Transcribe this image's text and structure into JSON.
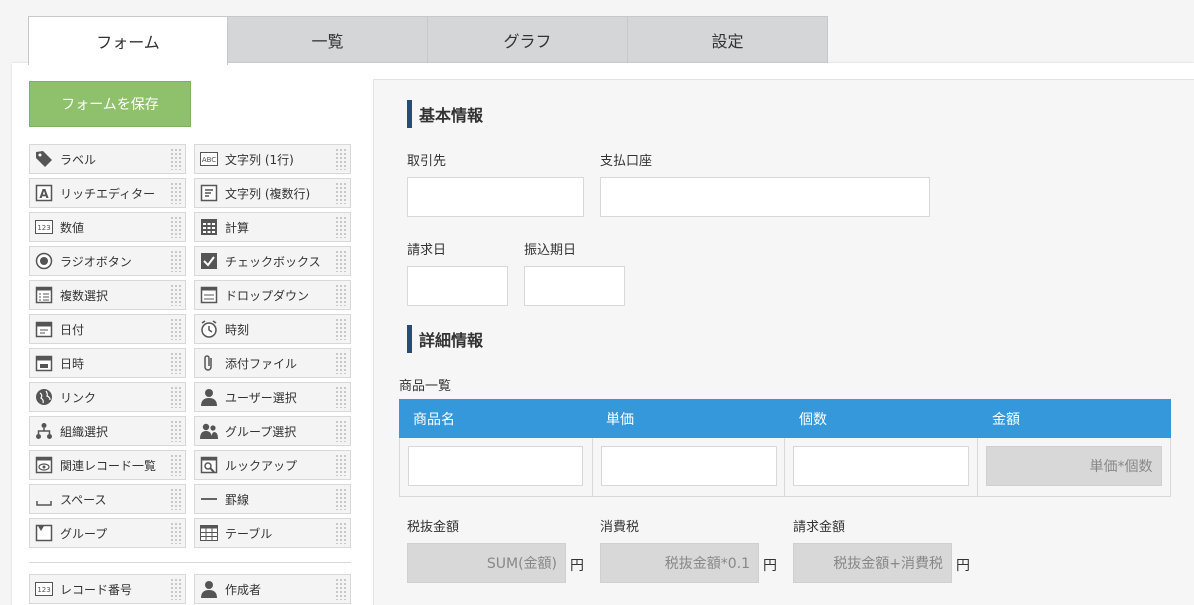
{
  "tabs": [
    {
      "label": "フォーム"
    },
    {
      "label": "一覧"
    },
    {
      "label": "グラフ"
    },
    {
      "label": "設定"
    }
  ],
  "save_button": "フォームを保存",
  "palette": [
    {
      "label": "ラベル",
      "icon": "tag-icon"
    },
    {
      "label": "文字列 (1行)",
      "icon": "abc-icon"
    },
    {
      "label": "リッチエディター",
      "icon": "rich-editor-icon"
    },
    {
      "label": "文字列 (複数行)",
      "icon": "multiline-text-icon"
    },
    {
      "label": "数値",
      "icon": "number-icon"
    },
    {
      "label": "計算",
      "icon": "calculator-icon"
    },
    {
      "label": "ラジオボタン",
      "icon": "radio-icon"
    },
    {
      "label": "チェックボックス",
      "icon": "checkbox-icon"
    },
    {
      "label": "複数選択",
      "icon": "multi-select-icon"
    },
    {
      "label": "ドロップダウン",
      "icon": "dropdown-icon"
    },
    {
      "label": "日付",
      "icon": "date-icon"
    },
    {
      "label": "時刻",
      "icon": "clock-icon"
    },
    {
      "label": "日時",
      "icon": "datetime-icon"
    },
    {
      "label": "添付ファイル",
      "icon": "paperclip-icon"
    },
    {
      "label": "リンク",
      "icon": "globe-icon"
    },
    {
      "label": "ユーザー選択",
      "icon": "user-icon"
    },
    {
      "label": "組織選択",
      "icon": "org-icon"
    },
    {
      "label": "グループ選択",
      "icon": "group-icon"
    },
    {
      "label": "関連レコード一覧",
      "icon": "related-records-icon"
    },
    {
      "label": "ルックアップ",
      "icon": "lookup-icon"
    },
    {
      "label": "スペース",
      "icon": "space-icon"
    },
    {
      "label": "罫線",
      "icon": "line-icon"
    },
    {
      "label": "グループ",
      "icon": "group-folder-icon"
    },
    {
      "label": "テーブル",
      "icon": "table-icon"
    }
  ],
  "palette_system": [
    {
      "label": "レコード番号",
      "icon": "number-icon"
    },
    {
      "label": "作成者",
      "icon": "user-icon"
    }
  ],
  "form": {
    "section1": "基本情報",
    "torihikisaki": "取引先",
    "shiharai_koza": "支払口座",
    "seikyubi": "請求日",
    "furikomi_kijitsu": "振込期日",
    "section2": "詳細情報",
    "table_title": "商品一覧",
    "table_headers": [
      "商品名",
      "単価",
      "個数",
      "金額"
    ],
    "amount_formula": "単価*個数",
    "zeinuki_label": "税抜金額",
    "zeinuki_formula": "SUM(金額)",
    "shohizei_label": "消費税",
    "shohizei_formula": "税抜金額*0.1",
    "seikyu_label": "請求金額",
    "seikyu_formula": "税抜金額+消費税",
    "unit": "円"
  }
}
